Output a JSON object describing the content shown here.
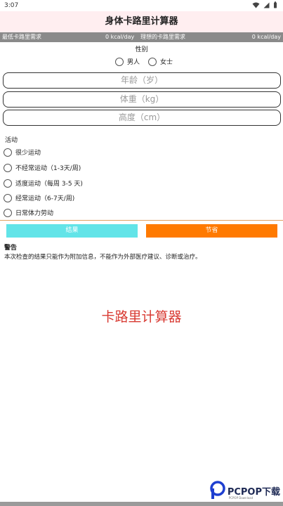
{
  "status": {
    "time": "3:07"
  },
  "app": {
    "title": "身体卡路里计算器"
  },
  "calories": {
    "min_label": "最低卡路里需求",
    "min_value": "0 kcal/day",
    "ideal_label": "理想的卡路里需求",
    "ideal_value": "0 kcal/day"
  },
  "gender": {
    "label": "性别",
    "options": [
      "男人",
      "女士"
    ]
  },
  "inputs": {
    "age_placeholder": "年龄（岁）",
    "weight_placeholder": "体重（kg）",
    "height_placeholder": "高度（cm）"
  },
  "activity": {
    "label": "活动",
    "options": [
      "很少运动",
      "不经常运动（1-3天/周)",
      "适度运动（每周 3-5 天)",
      "经常运动（6-7天/周)",
      "日常体力劳动"
    ]
  },
  "buttons": {
    "result": "结果",
    "save": "节省"
  },
  "warning": {
    "title": "警告",
    "text": "本次检查的结果只能作为附加信息，不能作为外部医疗建议、诊断或治疗。"
  },
  "banner": {
    "title": "卡路里计算器"
  },
  "watermark": {
    "text": "PCPOP下载",
    "sub": "PCPOP Download"
  },
  "colors": {
    "result_button": "#62e4e8",
    "save_button": "#ff7a00",
    "banner_title": "#d83a32",
    "title_bg": "#ffeef0"
  }
}
